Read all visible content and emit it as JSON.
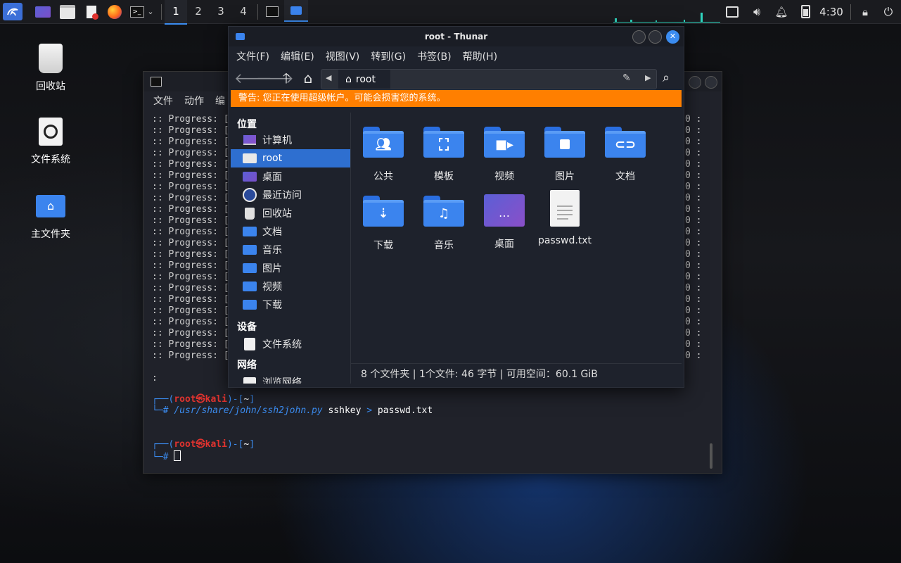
{
  "panel": {
    "workspaces": [
      "1",
      "2",
      "3",
      "4"
    ],
    "active_workspace": "1",
    "clock": "4:30"
  },
  "desktop": {
    "icons": [
      {
        "label": "回收站"
      },
      {
        "label": "文件系统"
      },
      {
        "label": "主文件夹"
      }
    ]
  },
  "terminal": {
    "menu": [
      "文件",
      "动作",
      "编"
    ],
    "progress_lines": [
      ":: Progress: [",
      ":: Progress: [",
      ":: Progress: [",
      ":: Progress: [",
      ":: Progress: [",
      ":: Progress: [",
      ":: Progress: [",
      ":: Progress: [",
      ":: Progress: [",
      ":: Progress: [",
      ":: Progress: [",
      ":: Progress: [",
      ":: Progress: [",
      ":: Progress: [",
      ":: Progress: [",
      ":: Progress: [",
      ":: Progress: [",
      ":: Progress: [",
      ":: Progress: [",
      ":: Progress: [",
      ":: Progress: [",
      ":: Progress: ["
    ],
    "right_column": "0 :",
    "colon_line": ":",
    "prompt_open": "┌──(",
    "prompt_user": "root㉿kali",
    "prompt_mid": ")-[",
    "prompt_dir": "~",
    "prompt_close": "]",
    "prompt_hash": "└─#",
    "command_path": "/usr/share/john/ssh2john.py",
    "command_args": " sshkey ",
    "command_redirect": ">",
    "command_file": " passwd.txt"
  },
  "thunar": {
    "title": "root - Thunar",
    "menu": [
      "文件(F)",
      "编辑(E)",
      "视图(V)",
      "转到(G)",
      "书签(B)",
      "帮助(H)"
    ],
    "path_label": "root",
    "warning": "警告: 您正在使用超级帐户。可能会损害您的系统。",
    "sidebar": {
      "places_header": "位置",
      "places": [
        "计算机",
        "root",
        "桌面",
        "最近访问",
        "回收站",
        "文档",
        "音乐",
        "图片",
        "视频",
        "下载"
      ],
      "devices_header": "设备",
      "devices": [
        "文件系统"
      ],
      "network_header": "网络",
      "network": [
        "浏览网络"
      ]
    },
    "files": [
      {
        "label": "公共",
        "icon": "people-icon"
      },
      {
        "label": "模板",
        "icon": "template-icon"
      },
      {
        "label": "视频",
        "icon": "video-icon"
      },
      {
        "label": "图片",
        "icon": "image-icon"
      },
      {
        "label": "文档",
        "icon": "paperclip-icon"
      },
      {
        "label": "下载",
        "icon": "download-icon"
      },
      {
        "label": "音乐",
        "icon": "music-icon"
      },
      {
        "label": "桌面",
        "icon": "desktop-icon"
      },
      {
        "label": "passwd.txt",
        "icon": "text-file-icon"
      }
    ],
    "status": "8 个文件夹 | 1个文件: 46 字节 | 可用空间：60.1 GiB"
  },
  "colors": {
    "accent": "#3b8cf0",
    "warning": "#ff7f00",
    "selection": "#2e6fd0",
    "prompt_red": "#e0332f"
  }
}
